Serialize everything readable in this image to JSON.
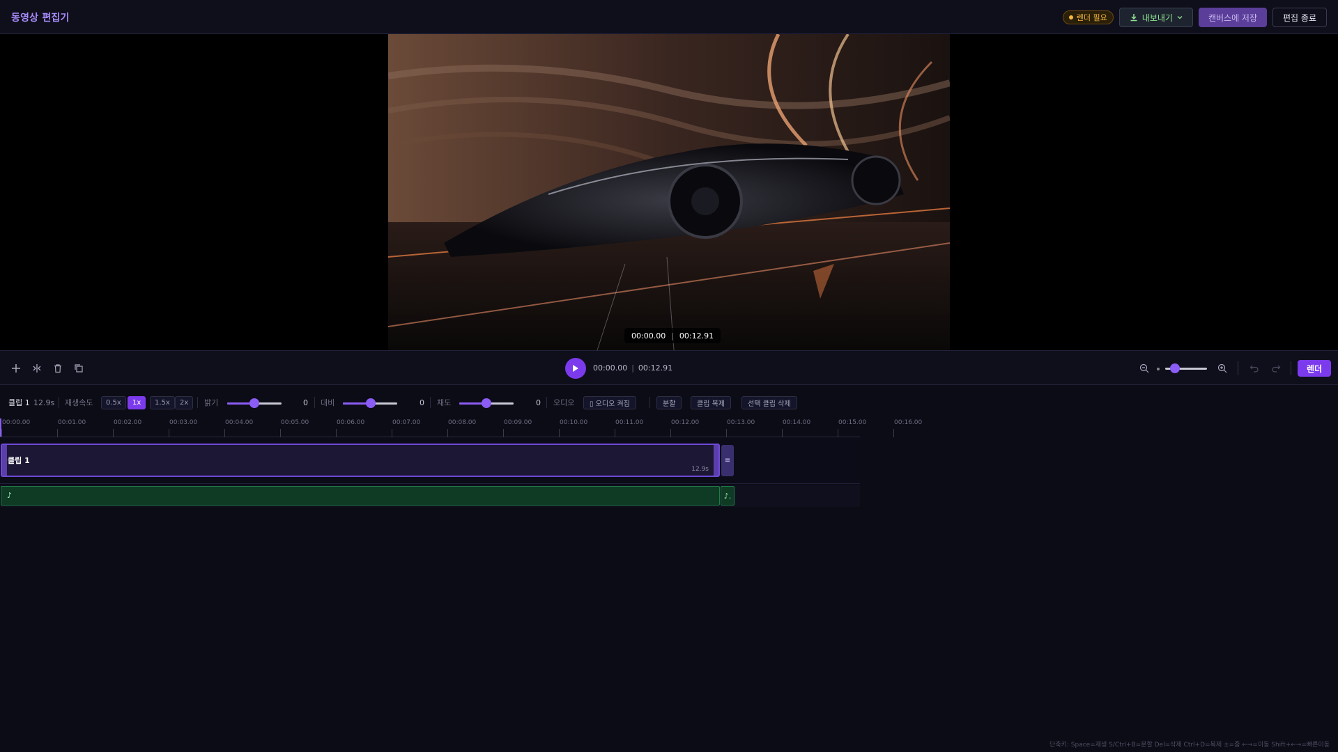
{
  "header": {
    "title": "동영상 편집기",
    "render_badge": "렌더 필요",
    "export_label": "내보내기",
    "save_canvas_label": "캔버스에 저장",
    "end_edit_label": "편집 종료"
  },
  "preview": {
    "current_time": "00:00.00",
    "total_time": "00:12.91"
  },
  "transport": {
    "current_time": "00:00.00",
    "total_time": "00:12.91",
    "render_label": "렌더"
  },
  "props": {
    "clip_name": "클립 1",
    "clip_duration": "12.9s",
    "speed_label": "재생속도",
    "speed_options": [
      "0.5x",
      "1x",
      "1.5x",
      "2x"
    ],
    "speed_selected": "1x",
    "brightness_label": "밝기",
    "brightness_value": "0",
    "contrast_label": "대비",
    "contrast_value": "0",
    "saturation_label": "채도",
    "saturation_value": "0",
    "audio_label": "오디오",
    "audio_toggle_label": "▯ 오디오 켜짐",
    "split_label": "분할",
    "duplicate_label": "클립 복제",
    "delete_selected_label": "선택 클립 삭제"
  },
  "timeline": {
    "ticks": [
      "00:00.00",
      "00:01.00",
      "00:02.00",
      "00:03.00",
      "00:04.00",
      "00:05.00",
      "00:06.00",
      "00:07.00",
      "00:08.00",
      "00:09.00",
      "00:10.00",
      "00:11.00",
      "00:12.00",
      "00:13.00",
      "00:14.00",
      "00:15.00",
      "00:16.00"
    ],
    "clip_label": "클립 1",
    "clip_length": "12.9s",
    "audio_note": "♪",
    "audio_extra_note": "♪."
  },
  "footer": {
    "shortcuts": "단축키: Space=재생 S/Ctrl+B=분할 Del=삭제 Ctrl+D=복제 ±=줌 ←→=이동 Shift+←→=빠른이동"
  },
  "colors": {
    "accent": "#7c3aed",
    "audio_track": "#0f3a24",
    "badge": "#f5b841"
  }
}
